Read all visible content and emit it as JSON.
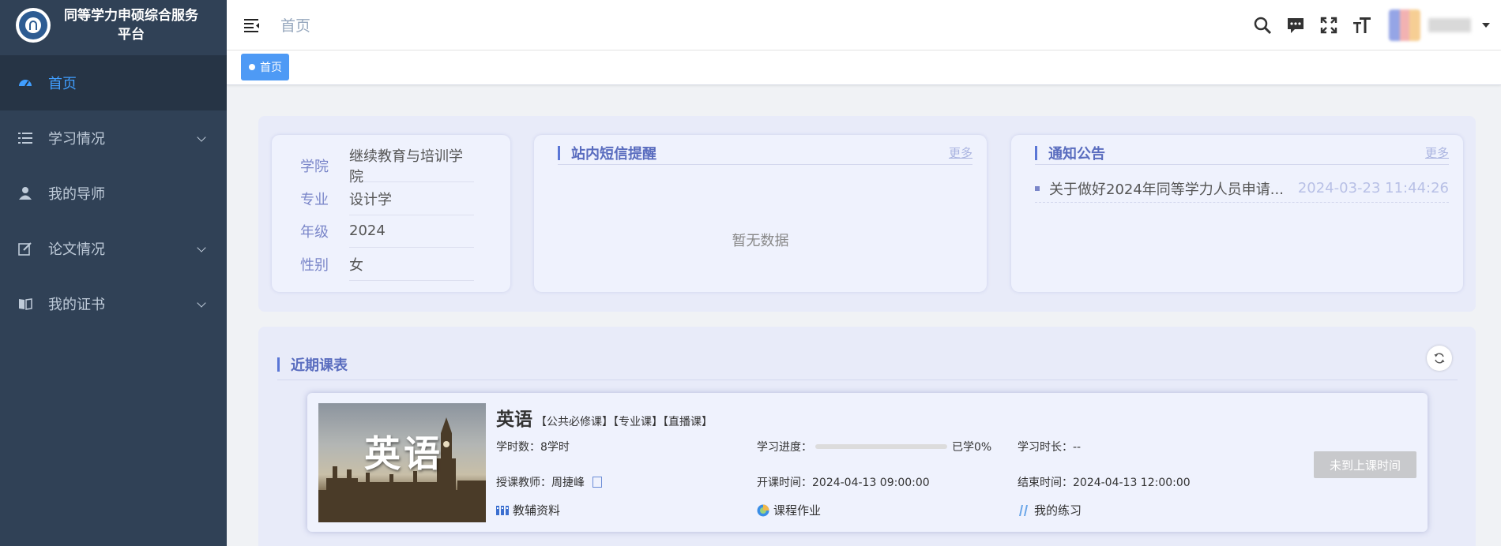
{
  "app": {
    "title": "同等学力申硕综合服务平台"
  },
  "sidebar": {
    "items": [
      {
        "label": "首页",
        "icon": "dashboard-icon"
      },
      {
        "label": "学习情况",
        "icon": "list-icon"
      },
      {
        "label": "我的导师",
        "icon": "user-icon"
      },
      {
        "label": "论文情况",
        "icon": "edit-icon"
      },
      {
        "label": "我的证书",
        "icon": "book-icon"
      }
    ]
  },
  "header": {
    "breadcrumb": "首页"
  },
  "tags": {
    "active": "首页"
  },
  "student": {
    "rows": [
      {
        "label": "学院",
        "value": "继续教育与培训学院"
      },
      {
        "label": "专业",
        "value": "设计学"
      },
      {
        "label": "年级",
        "value": "2024"
      },
      {
        "label": "性别",
        "value": "女"
      }
    ]
  },
  "messages": {
    "title": "站内短信提醒",
    "more": "更多",
    "empty": "暂无数据"
  },
  "notices": {
    "title": "通知公告",
    "more": "更多",
    "items": [
      {
        "text": "关于做好2024年同等学力人员申请...",
        "date": "2024-03-23 11:44:26"
      }
    ]
  },
  "schedule": {
    "title": "近期课表",
    "course": {
      "cover_text": "英语",
      "name": "英语",
      "tags": "【公共必修课】【专业课】【直播课】",
      "hours": "学时数：8学时",
      "progress_label": "学习进度：",
      "progress_value": 0,
      "progress_text": "已学0%",
      "duration": "学习时长：--",
      "teacher": "授课教师：周捷峰",
      "start": "开课时间：2024-04-13 09:00:00",
      "end": "结束时间：2024-04-13 12:00:00",
      "res_materials": "教辅资料",
      "res_homework": "课程作业",
      "res_practice": "我的练习",
      "button": "未到上课时间"
    }
  },
  "colors": {
    "sidebar_bg": "#304156",
    "accent": "#409eff",
    "panel_bg": "#e8ebf9",
    "card_title": "#5a6dbf"
  }
}
